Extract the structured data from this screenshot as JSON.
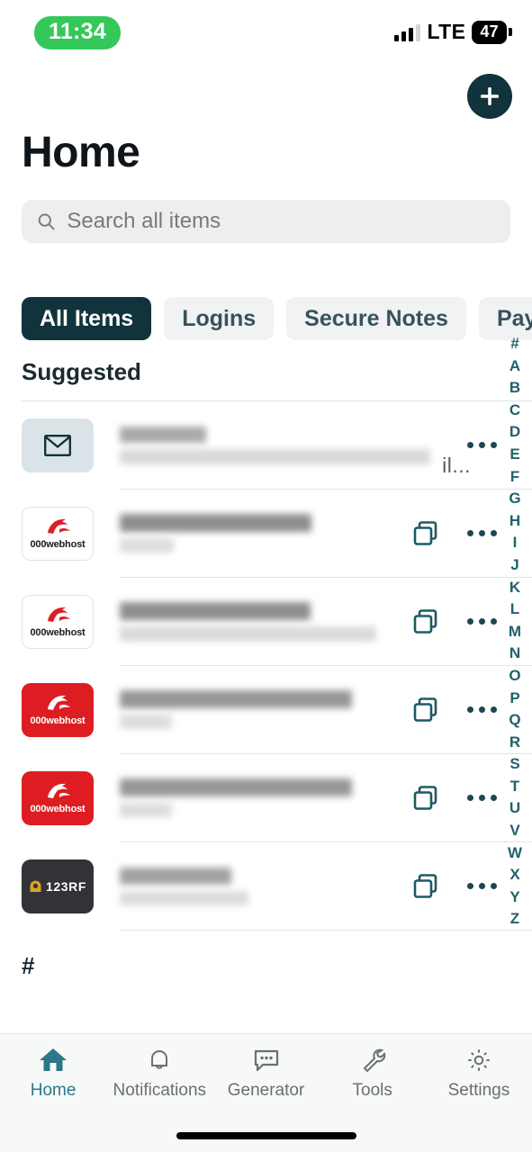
{
  "status_bar": {
    "time": "11:34",
    "network": "LTE",
    "battery": "47",
    "signal_icon": "signal-bars-icon",
    "battery_icon": "battery-icon"
  },
  "header": {
    "title": "Home",
    "add_button_icon": "plus-icon",
    "add_button_label": "Add item"
  },
  "search": {
    "placeholder": "Search all items",
    "value": "",
    "icon": "search-icon"
  },
  "filter_tabs": [
    {
      "label": "All Items",
      "active": true
    },
    {
      "label": "Logins",
      "active": false
    },
    {
      "label": "Secure Notes",
      "active": false
    },
    {
      "label": "Payme",
      "active": false
    }
  ],
  "list": {
    "section_title": "Suggested",
    "footer_section_title": "#",
    "rows": [
      {
        "icon_type": "mail",
        "icon_name": "envelope-icon",
        "title_redacted": true,
        "subtitle_redacted": true,
        "visible_text_fragment": "il...",
        "has_copy": false,
        "has_more": true
      },
      {
        "icon_type": "webhost-light",
        "icon_name": "000webhost-logo",
        "icon_label": "000webhost",
        "title_redacted": true,
        "subtitle_redacted": true,
        "has_copy": true,
        "has_more": true
      },
      {
        "icon_type": "webhost-light",
        "icon_name": "000webhost-logo",
        "icon_label": "000webhost",
        "title_redacted": true,
        "subtitle_redacted": true,
        "has_copy": true,
        "has_more": true
      },
      {
        "icon_type": "webhost-red",
        "icon_name": "000webhost-logo",
        "icon_label": "000webhost",
        "title_redacted": true,
        "subtitle_redacted": true,
        "has_copy": true,
        "has_more": true
      },
      {
        "icon_type": "webhost-red",
        "icon_name": "000webhost-logo",
        "icon_label": "000webhost",
        "title_redacted": true,
        "subtitle_redacted": true,
        "has_copy": true,
        "has_more": true
      },
      {
        "icon_type": "rf123",
        "icon_name": "123rf-logo",
        "icon_label": "123RF",
        "title_redacted": true,
        "subtitle_redacted": true,
        "has_copy": true,
        "has_more": true
      }
    ],
    "copy_icon": "copy-icon",
    "more_icon": "more-horizontal-icon"
  },
  "alphabet_index": [
    "#",
    "A",
    "B",
    "C",
    "D",
    "E",
    "F",
    "G",
    "H",
    "I",
    "J",
    "K",
    "L",
    "M",
    "N",
    "O",
    "P",
    "Q",
    "R",
    "S",
    "T",
    "U",
    "V",
    "W",
    "X",
    "Y",
    "Z"
  ],
  "tabbar": [
    {
      "label": "Home",
      "icon": "home-icon",
      "active": true
    },
    {
      "label": "Notifications",
      "icon": "bell-icon",
      "active": false
    },
    {
      "label": "Generator",
      "icon": "speech-bubble-icon",
      "active": false
    },
    {
      "label": "Tools",
      "icon": "wrench-icon",
      "active": false
    },
    {
      "label": "Settings",
      "icon": "gear-icon",
      "active": false
    }
  ],
  "colors": {
    "accent_dark": "#11333b",
    "accent_teal": "#22616b",
    "active_tab_text": "#2b7886",
    "time_pill_green": "#34c759",
    "webhost_red": "#dd1d21",
    "rf123_bg": "#313336",
    "rf123_gold": "#d8a32a"
  }
}
